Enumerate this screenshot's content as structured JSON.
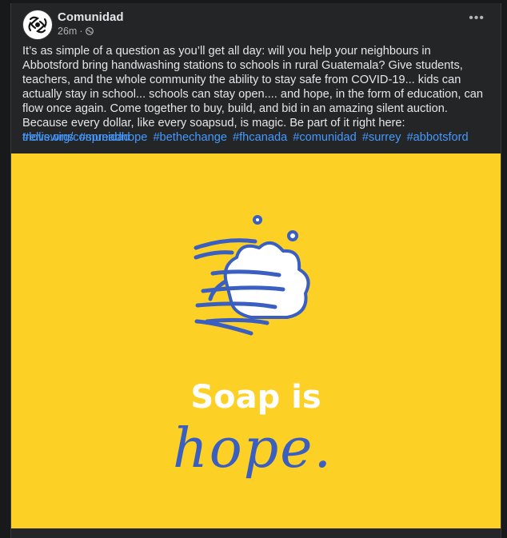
{
  "post": {
    "author": "Comunidad",
    "time": "26m",
    "separator": "·",
    "privacy_icon": "globe-icon",
    "more_label": "•••",
    "body": "It’s as simple of a question as you’ll get all day: will you help your neighbours in Abbotsford bring handwashing stations to schools in rural Guatemala? Give students, teachers, and the whole community the ability to stay safe from COVID-19... kids can actually stay in school... schools can stay open.... and hope, in the form of education, can flow once again. Come together to buy, build, and bid in an amazing silent auction. Because every dollar, like every soapsud, is magic. Be part of it right here: ",
    "link": "trellis.org/comunidad",
    "hashtags": [
      "#lovewins",
      "#spreadhope",
      "#bethechange",
      "#fhcanada",
      "#comunidad",
      "#surrey",
      "#abbotsford"
    ]
  },
  "image": {
    "icon": "handwashing-icon",
    "headline": "Soap is",
    "script": "hope.",
    "background_color": "#fcd025",
    "accent_color": "#3a5fc1"
  }
}
